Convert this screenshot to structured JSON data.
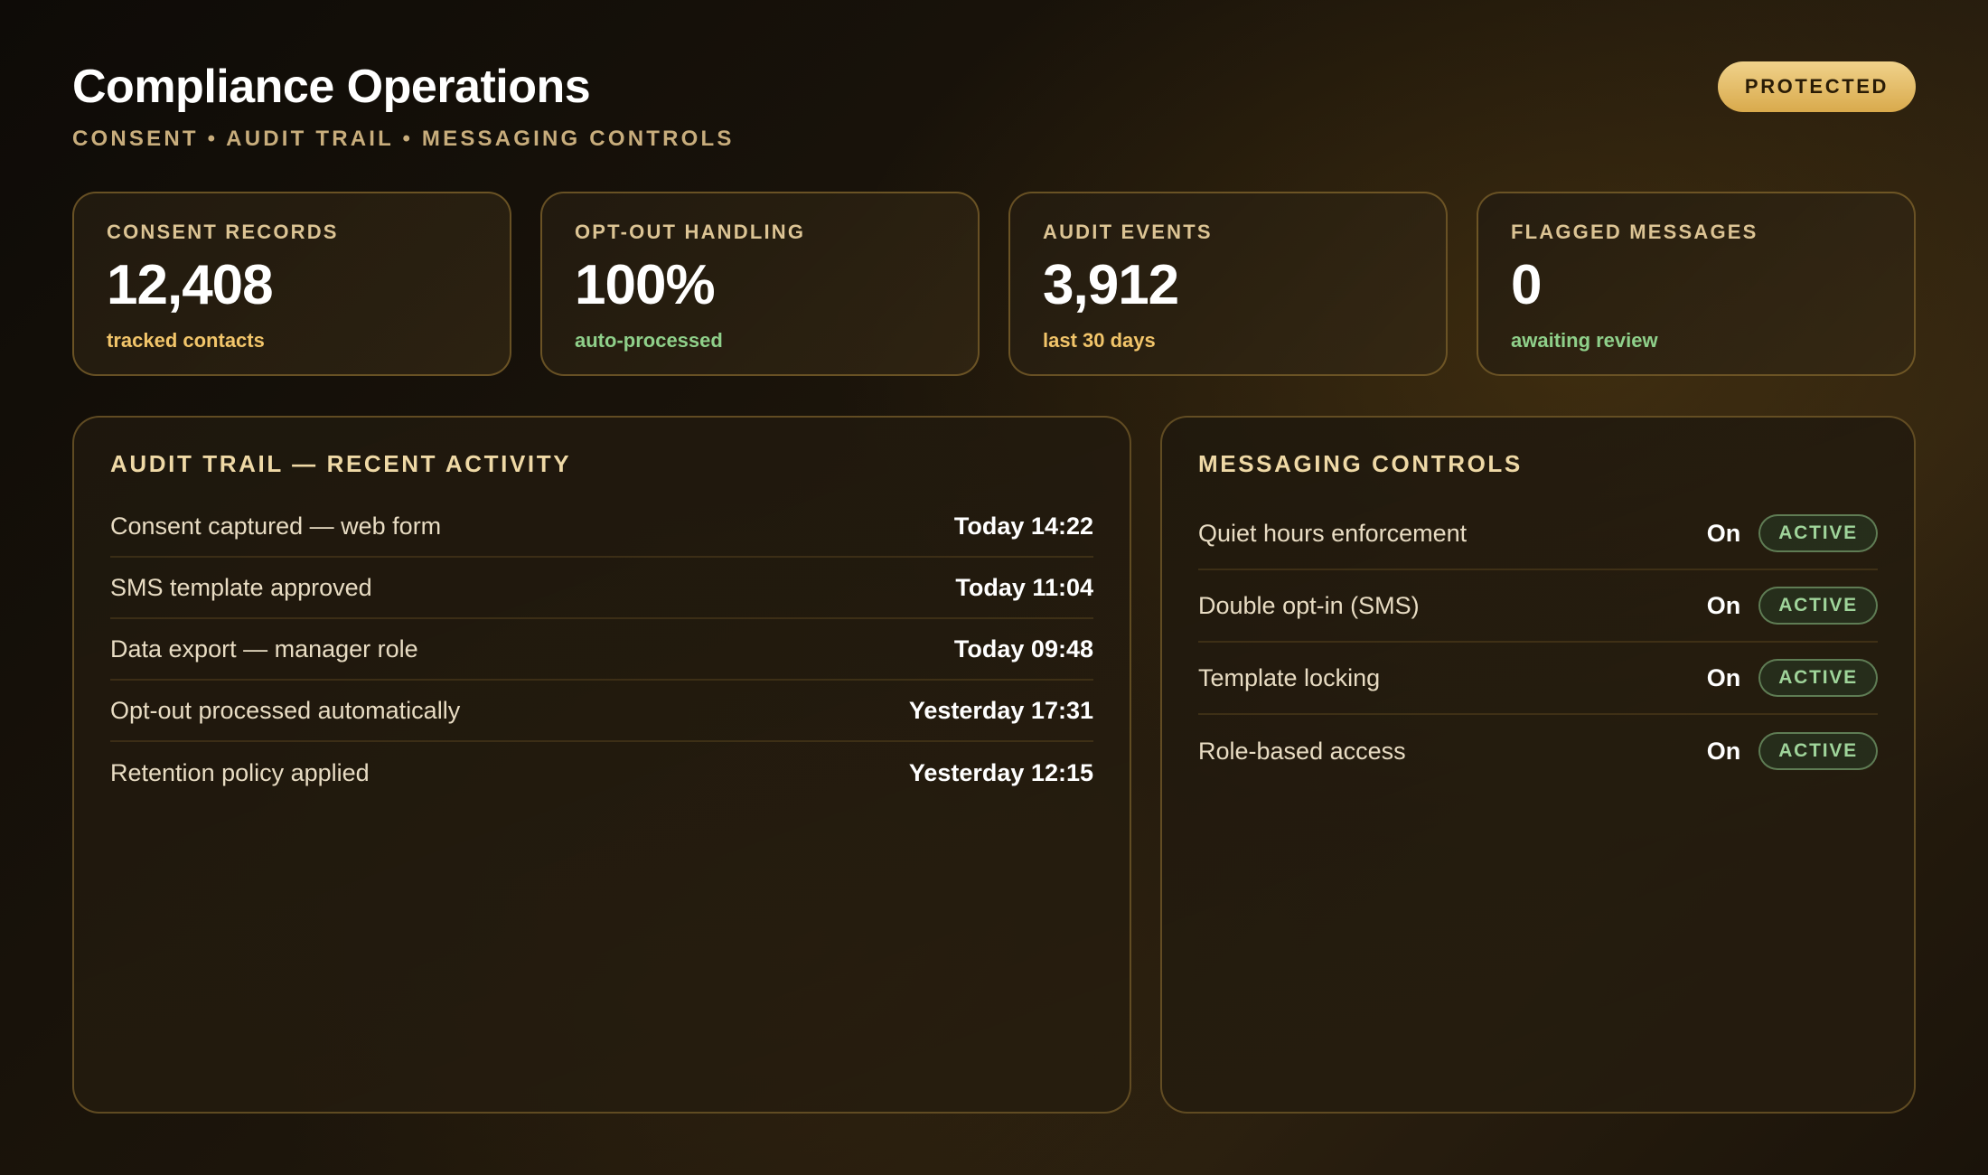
{
  "header": {
    "title": "Compliance Operations",
    "subtitle": "CONSENT • AUDIT TRAIL • MESSAGING CONTROLS",
    "badge": "PROTECTED"
  },
  "stats": [
    {
      "label": "CONSENT RECORDS",
      "value": "12,408",
      "note": "tracked contacts",
      "note_color": "#f2c56a"
    },
    {
      "label": "OPT-OUT HANDLING",
      "value": "100%",
      "note": "auto-processed",
      "note_color": "#8fd08a"
    },
    {
      "label": "AUDIT EVENTS",
      "value": "3,912",
      "note": "last 30 days",
      "note_color": "#f2c56a"
    },
    {
      "label": "FLAGGED MESSAGES",
      "value": "0",
      "note": "awaiting review",
      "note_color": "#8fd08a"
    }
  ],
  "audit": {
    "title": "AUDIT TRAIL — RECENT ACTIVITY",
    "rows": [
      {
        "event": "Consent captured — web form",
        "time": "Today 14:22"
      },
      {
        "event": "SMS template approved",
        "time": "Today 11:04"
      },
      {
        "event": "Data export — manager role",
        "time": "Today 09:48"
      },
      {
        "event": "Opt-out processed automatically",
        "time": "Yesterday 17:31"
      },
      {
        "event": "Retention policy applied",
        "time": "Yesterday 12:15"
      }
    ]
  },
  "messaging": {
    "title": "MESSAGING CONTROLS",
    "controls": [
      {
        "label": "Quiet hours enforcement",
        "state": "On",
        "status": "ACTIVE"
      },
      {
        "label": "Double opt-in (SMS)",
        "state": "On",
        "status": "ACTIVE"
      },
      {
        "label": "Template locking",
        "state": "On",
        "status": "ACTIVE"
      },
      {
        "label": "Role-based access",
        "state": "On",
        "status": "ACTIVE"
      }
    ]
  },
  "colors": {
    "accent_gold": "#d9aa4c",
    "positive_green": "#8fd08a",
    "background": "#1c150b"
  }
}
